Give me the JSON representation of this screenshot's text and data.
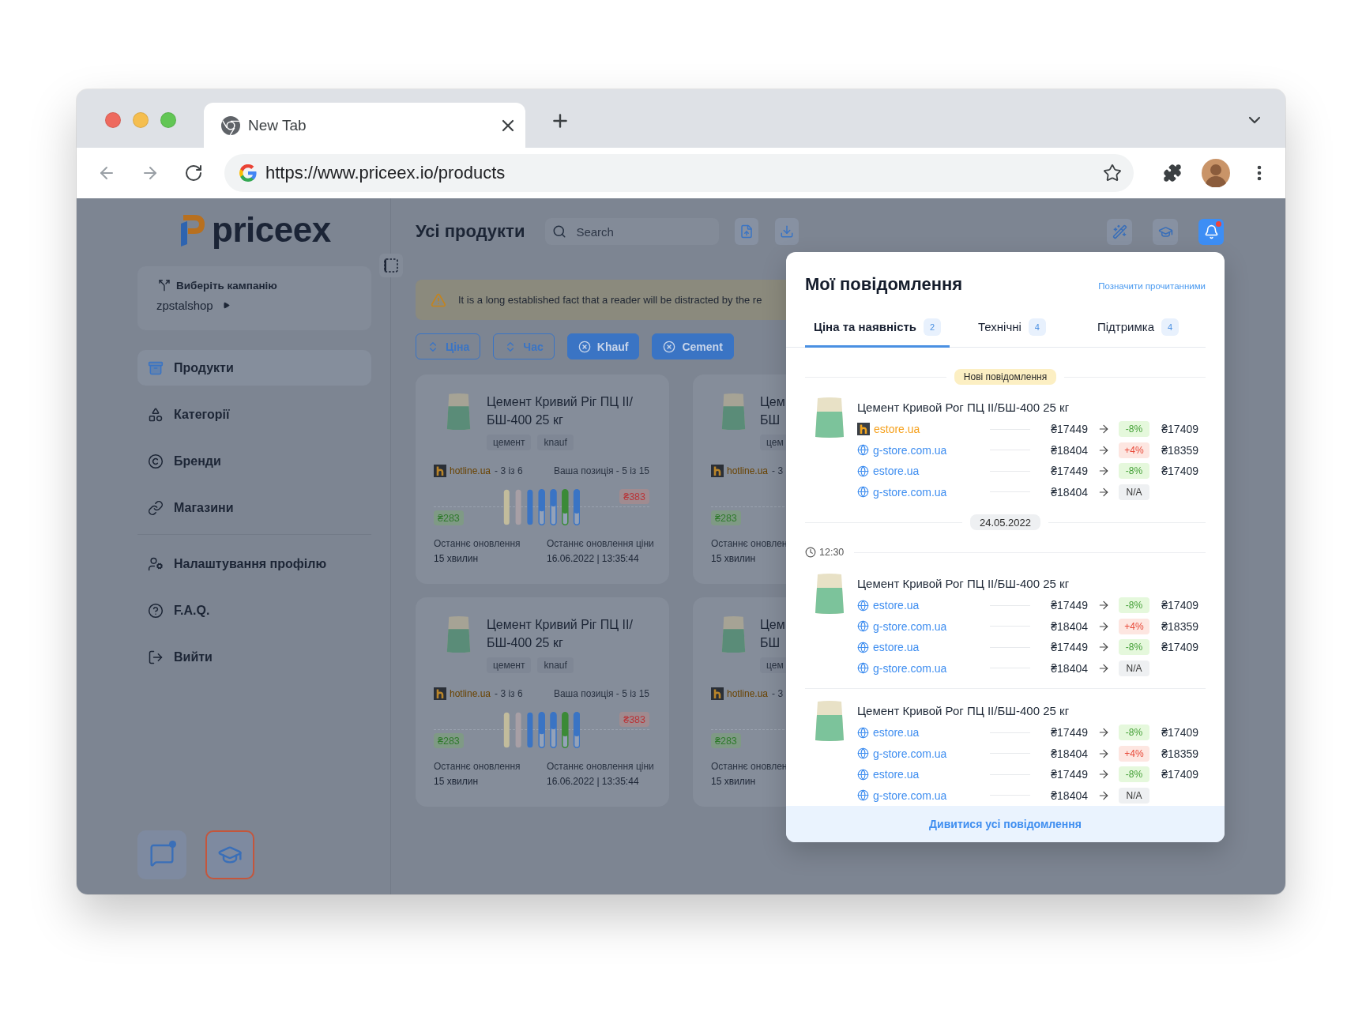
{
  "browser": {
    "tab_title": "New Tab",
    "url": "https://www.priceex.io/products"
  },
  "sidebar": {
    "logo": "priceex",
    "campaign": {
      "label": "Виберіть кампанію",
      "value": "zpstalshop"
    },
    "menu_groups": [
      {
        "items": [
          {
            "label": "Продукти",
            "selected": true
          },
          {
            "label": "Категорії",
            "selected": false
          },
          {
            "label": "Бренди",
            "selected": false
          },
          {
            "label": "Магазини",
            "selected": false
          }
        ]
      },
      {
        "items": [
          {
            "label": "Налаштування профілю",
            "selected": false
          },
          {
            "label": "F.A.Q.",
            "selected": false
          },
          {
            "label": "Вийти",
            "selected": false
          }
        ]
      }
    ],
    "bottom_buttons": [
      {
        "unread": true,
        "highlighted": false
      },
      {
        "unread": false,
        "highlighted": true
      }
    ]
  },
  "header": {
    "title": "Усі продукти",
    "search": {
      "placeholder": "Search"
    },
    "actions": [
      {
        "selected": false,
        "unread": false
      },
      {
        "selected": false,
        "unread": false
      },
      {
        "selected": true,
        "unread": true
      }
    ]
  },
  "alert": {
    "text": "It is a long established fact that a reader will be distracted by the re"
  },
  "filters": [
    {
      "label": "Ціна",
      "kind": "sort"
    },
    {
      "label": "Час",
      "kind": "sort"
    },
    {
      "label": "Khauf",
      "kind": "chip"
    },
    {
      "label": "Cement",
      "kind": "chip"
    }
  ],
  "cards": [
    {
      "kind": "full",
      "title_lines": [
        "Цемент Кривий Ріг ПЦ II/",
        "БШ-400 25 кг"
      ],
      "tags": [
        "цемент",
        "knauf"
      ],
      "source": "hotline.ua",
      "rank": "- 3 із 6",
      "position": "Ваша позиція - 5 із 15",
      "max_price": "₴383",
      "min_price": "₴283",
      "updated": {
        "label": "Останнє оновлення",
        "value": "15 хвилин"
      },
      "price_updated": {
        "label": "Останнє оновлення ціни",
        "value": "16.06.2022 | 13:35:44"
      }
    },
    {
      "kind": "cut",
      "title_lines": [
        "Цем",
        "БШ"
      ],
      "tags": [
        "цем"
      ],
      "source": "hotline.ua",
      "rank": "- 3",
      "min_price": "₴283",
      "updated": {
        "label": "Останнє оновлен",
        "value": "15 хвилин"
      }
    },
    {
      "kind": "full",
      "title_lines": [
        "Цемент Кривий Ріг ПЦ II/",
        "БШ-400 25 кг"
      ],
      "tags": [
        "цемент",
        "knauf"
      ],
      "source": "hotline.ua",
      "rank": "- 3 із 6",
      "position": "Ваша позиція - 5 із 15",
      "max_price": "₴383",
      "min_price": "₴283",
      "updated": {
        "label": "Останнє оновлення",
        "value": "15 хвилин"
      },
      "price_updated": {
        "label": "Останнє оновлення ціни",
        "value": "16.06.2022 | 13:35:44"
      }
    },
    {
      "kind": "cut",
      "title_lines": [
        "Цем",
        "БШ"
      ],
      "tags": [
        "цем"
      ],
      "source": "hotline.ua",
      "rank": "- 3",
      "min_price": "₴283",
      "updated": {
        "label": "Останнє оновлен",
        "value": "15 хвилин"
      }
    }
  ],
  "notifications": {
    "title": "Мої повідомлення",
    "mark_read": "Позначити прочитанними",
    "tabs": [
      {
        "label": "Ціна та наявність",
        "count": "2",
        "selected": true
      },
      {
        "label": "Технічні",
        "count": "4",
        "selected": false
      },
      {
        "label": "Підтримка",
        "count": "4",
        "selected": false
      }
    ],
    "feed": [
      {
        "kind": "marker",
        "label": "Нові повідомлення"
      },
      {
        "kind": "product",
        "title": "Цемент Кривой Рог ПЦ II/БШ-400 25 кг",
        "offers": [
          {
            "kind": "hotline",
            "store": "estore.ua",
            "old_price": "₴17449",
            "change": {
              "text": "-8%",
              "kind": "down"
            },
            "new_price": "₴17409"
          },
          {
            "kind": "web",
            "store": "g-store.com.ua",
            "old_price": "₴18404",
            "change": {
              "text": "+4%",
              "kind": "up"
            },
            "new_price": "₴18359"
          },
          {
            "kind": "web",
            "store": "estore.ua",
            "old_price": "₴17449",
            "change": {
              "text": "-8%",
              "kind": "down"
            },
            "new_price": "₴17409"
          },
          {
            "kind": "web",
            "store": "g-store.com.ua",
            "old_price": "₴18404",
            "change": {
              "text": "N/A",
              "kind": "none"
            }
          }
        ]
      },
      {
        "kind": "date",
        "label": "24.05.2022"
      },
      {
        "kind": "time",
        "label": "12:30"
      },
      {
        "kind": "product",
        "title": "Цемент Кривой Рог ПЦ II/БШ-400 25 кг",
        "offers": [
          {
            "kind": "web",
            "store": "estore.ua",
            "old_price": "₴17449",
            "change": {
              "text": "-8%",
              "kind": "down"
            },
            "new_price": "₴17409"
          },
          {
            "kind": "web",
            "store": "g-store.com.ua",
            "old_price": "₴18404",
            "change": {
              "text": "+4%",
              "kind": "up"
            },
            "new_price": "₴18359"
          },
          {
            "kind": "web",
            "store": "estore.ua",
            "old_price": "₴17449",
            "change": {
              "text": "-8%",
              "kind": "down"
            },
            "new_price": "₴17409"
          },
          {
            "kind": "web",
            "store": "g-store.com.ua",
            "old_price": "₴18404",
            "change": {
              "text": "N/A",
              "kind": "none"
            }
          }
        ]
      },
      {
        "kind": "product",
        "title": "Цемент Кривой Рог ПЦ II/БШ-400 25 кг",
        "offers": [
          {
            "kind": "web",
            "store": "estore.ua",
            "old_price": "₴17449",
            "change": {
              "text": "-8%",
              "kind": "down"
            },
            "new_price": "₴17409"
          },
          {
            "kind": "web",
            "store": "g-store.com.ua",
            "old_price": "₴18404",
            "change": {
              "text": "+4%",
              "kind": "up"
            },
            "new_price": "₴18359"
          },
          {
            "kind": "web",
            "store": "estore.ua",
            "old_price": "₴17449",
            "change": {
              "text": "-8%",
              "kind": "down"
            },
            "new_price": "₴17409"
          },
          {
            "kind": "web",
            "store": "g-store.com.ua",
            "old_price": "₴18404",
            "change": {
              "text": "N/A",
              "kind": "none"
            }
          }
        ]
      }
    ],
    "footer": "Дивитися усі повідомлення"
  }
}
